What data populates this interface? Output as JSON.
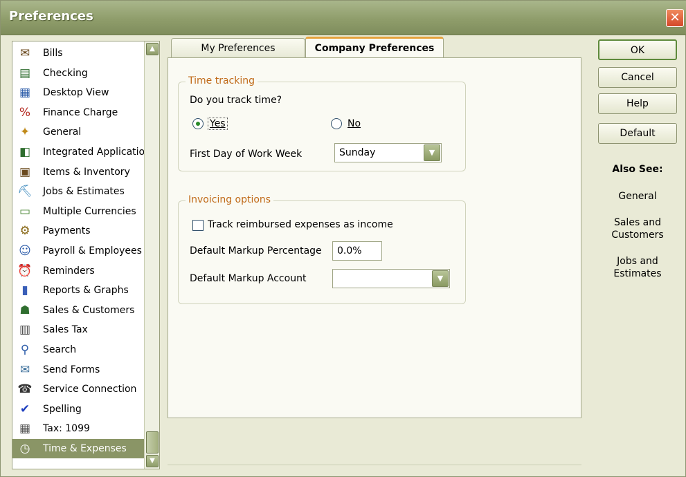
{
  "window": {
    "title": "Preferences"
  },
  "sidebar": {
    "items": [
      {
        "label": "Bills",
        "icon": "bills-icon"
      },
      {
        "label": "Checking",
        "icon": "checking-icon"
      },
      {
        "label": "Desktop View",
        "icon": "desktop-view-icon"
      },
      {
        "label": "Finance Charge",
        "icon": "finance-charge-icon"
      },
      {
        "label": "General",
        "icon": "general-icon"
      },
      {
        "label": "Integrated Applicatio",
        "icon": "integrated-applications-icon"
      },
      {
        "label": "Items & Inventory",
        "icon": "items-inventory-icon"
      },
      {
        "label": "Jobs & Estimates",
        "icon": "jobs-estimates-icon"
      },
      {
        "label": "Multiple Currencies",
        "icon": "multiple-currencies-icon"
      },
      {
        "label": "Payments",
        "icon": "payments-icon"
      },
      {
        "label": "Payroll & Employees",
        "icon": "payroll-employees-icon"
      },
      {
        "label": "Reminders",
        "icon": "reminders-icon"
      },
      {
        "label": "Reports & Graphs",
        "icon": "reports-graphs-icon"
      },
      {
        "label": "Sales & Customers",
        "icon": "sales-customers-icon"
      },
      {
        "label": "Sales Tax",
        "icon": "sales-tax-icon"
      },
      {
        "label": "Search",
        "icon": "search-icon"
      },
      {
        "label": "Send Forms",
        "icon": "send-forms-icon"
      },
      {
        "label": "Service Connection",
        "icon": "service-connection-icon"
      },
      {
        "label": "Spelling",
        "icon": "spelling-icon"
      },
      {
        "label": "Tax: 1099",
        "icon": "tax-1099-icon"
      },
      {
        "label": "Time & Expenses",
        "icon": "time-expenses-icon",
        "selected": true
      }
    ]
  },
  "tabs": {
    "my_preferences": "My Preferences",
    "company_preferences": "Company Preferences"
  },
  "time_tracking": {
    "legend": "Time tracking",
    "question": "Do you track time?",
    "yes_label": "Yes",
    "no_label": "No",
    "selected": "Yes",
    "first_day_label": "First Day of Work Week",
    "first_day_value": "Sunday"
  },
  "invoicing": {
    "legend": "Invoicing options",
    "track_reimbursed_label": "Track reimbursed expenses as income",
    "track_reimbursed_checked": false,
    "markup_percentage_label": "Default Markup Percentage",
    "markup_percentage_value": "0.0%",
    "markup_account_label": "Default Markup Account",
    "markup_account_value": ""
  },
  "buttons": {
    "ok": "OK",
    "cancel": "Cancel",
    "help": "Help",
    "default": "Default"
  },
  "also_see": {
    "title": "Also See:",
    "links": [
      "General",
      "Sales and Customers",
      "Jobs and Estimates"
    ]
  },
  "colors": {
    "title_bar": "#8f9d6b",
    "selected_item": "#8a9566",
    "legend_text": "#c06a18",
    "active_tab_accent": "#e6a23c",
    "close_button": "#d4482a"
  }
}
